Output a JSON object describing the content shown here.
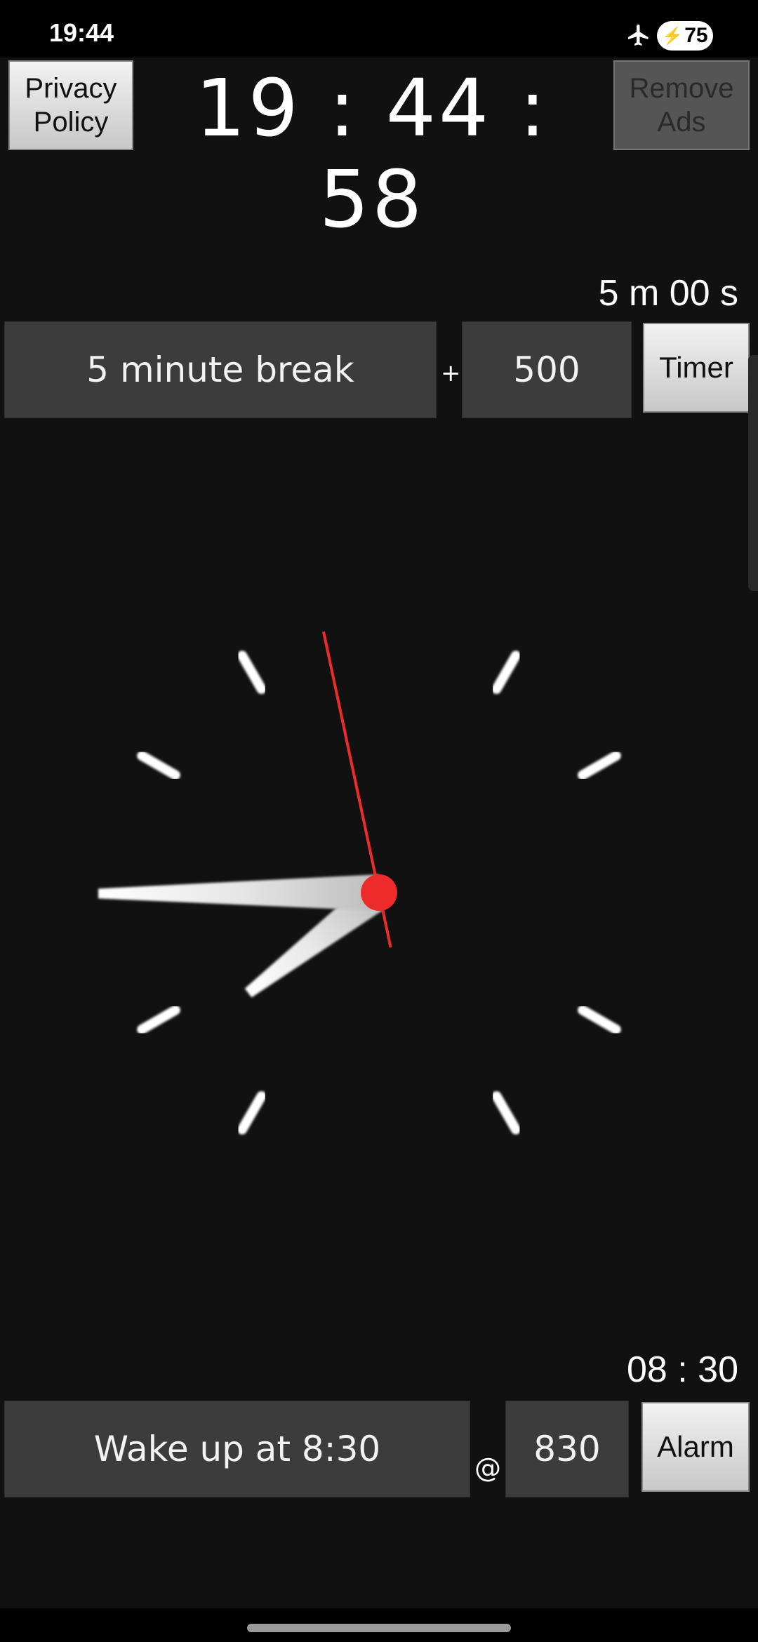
{
  "status_bar": {
    "time": "19:44",
    "battery_level": "75",
    "icons": [
      "airplane-icon",
      "charging-bolt-icon"
    ]
  },
  "header": {
    "privacy_button": "Privacy\nPolicy",
    "remove_ads_button": "Remove\nAds",
    "digital_time": "19 : 44 : 58"
  },
  "timer": {
    "remaining": "5 m 00 s",
    "label_value": "5 minute break",
    "separator": "+",
    "duration_value": "500",
    "button": "Timer"
  },
  "analog_clock": {
    "hours": 19,
    "minutes": 44,
    "seconds": 58,
    "colors": {
      "hands": "#ffffff",
      "second_hand": "#ee2b2b",
      "ticks": "#ffffff"
    }
  },
  "alarm": {
    "set_time": "08 : 30",
    "label_value": "Wake up at 8:30",
    "separator": "@",
    "time_value": "830",
    "button": "Alarm"
  },
  "colors": {
    "background": "#111111",
    "field_background": "#3c3c3c",
    "accent": "#ee2b2b"
  }
}
